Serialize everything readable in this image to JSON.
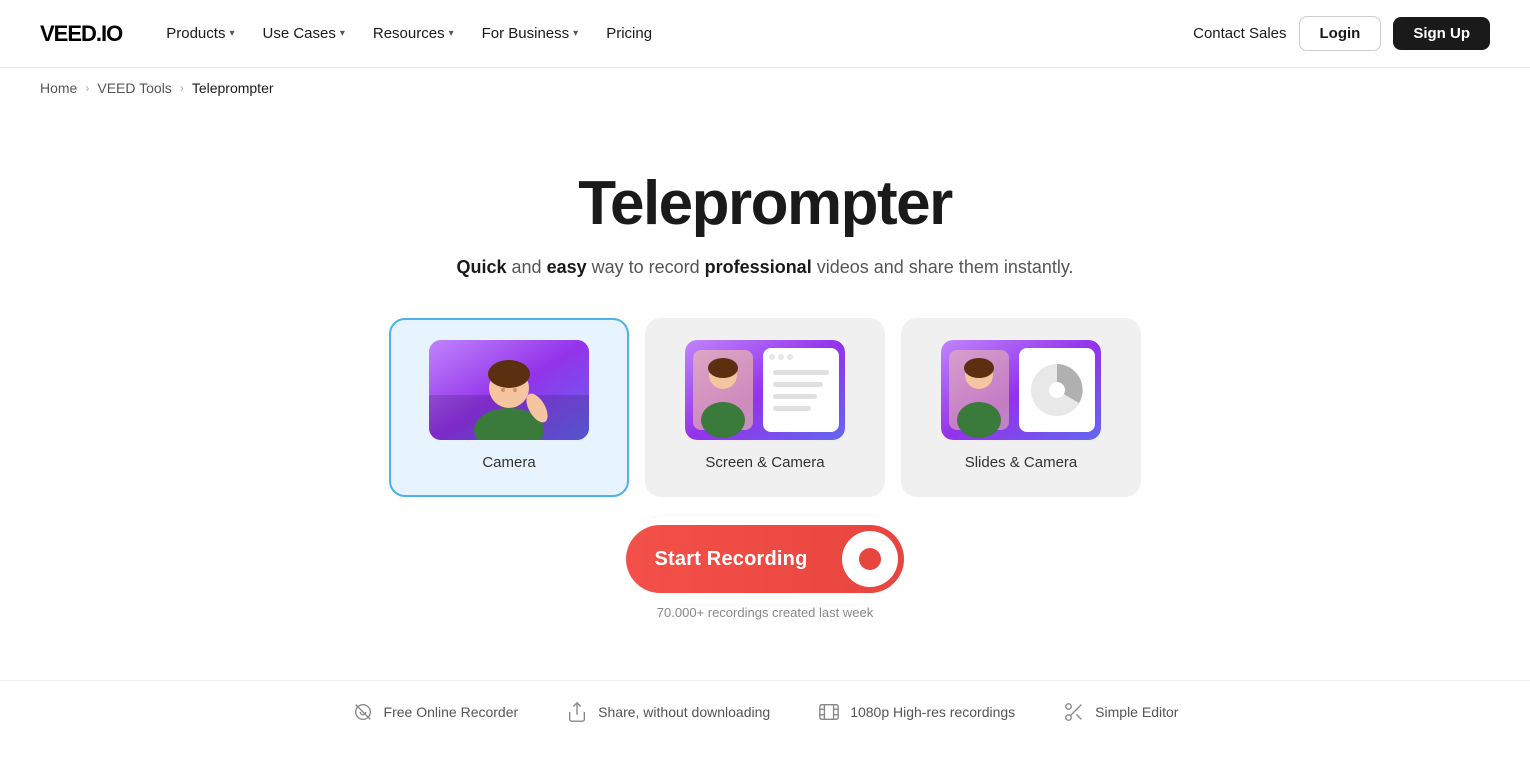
{
  "nav": {
    "logo": "VEED.IO",
    "items": [
      {
        "label": "Products",
        "has_chevron": true
      },
      {
        "label": "Use Cases",
        "has_chevron": true
      },
      {
        "label": "Resources",
        "has_chevron": true
      },
      {
        "label": "For Business",
        "has_chevron": true
      },
      {
        "label": "Pricing",
        "has_chevron": false
      }
    ],
    "contact_sales": "Contact Sales",
    "login": "Login",
    "signup": "Sign Up"
  },
  "breadcrumb": {
    "home": "Home",
    "tools": "VEED Tools",
    "current": "Teleprompter"
  },
  "hero": {
    "title": "Teleprompter",
    "subtitle_part1": "Quick",
    "subtitle_part2": " and ",
    "subtitle_part3": "easy",
    "subtitle_part4": " way to record ",
    "subtitle_part5": "professional",
    "subtitle_part6": " videos and share them instantly."
  },
  "mode_cards": [
    {
      "label": "Camera",
      "selected": true,
      "type": "camera"
    },
    {
      "label": "Screen & Camera",
      "selected": false,
      "type": "screen-camera"
    },
    {
      "label": "Slides & Camera",
      "selected": false,
      "type": "slides-camera"
    }
  ],
  "cta": {
    "start_recording": "Start Recording",
    "count_text": "70.000+ recordings created last week"
  },
  "features": [
    {
      "icon": "camera-off-icon",
      "text": "Free Online Recorder"
    },
    {
      "icon": "share-icon",
      "text": "Share, without downloading"
    },
    {
      "icon": "film-icon",
      "text": "1080p High-res recordings"
    },
    {
      "icon": "scissors-icon",
      "text": "Simple Editor"
    }
  ]
}
